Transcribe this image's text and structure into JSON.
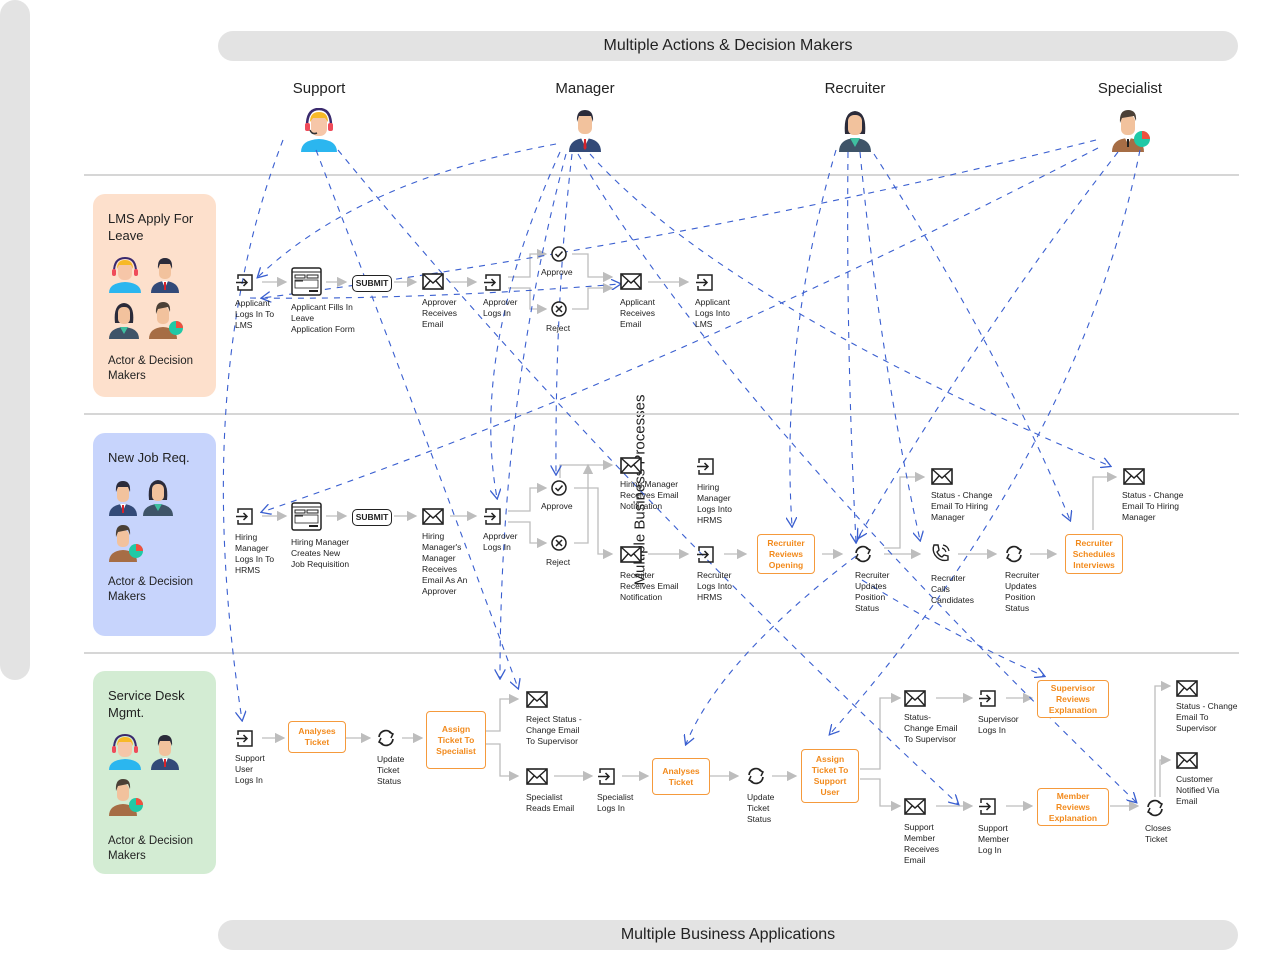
{
  "banners": {
    "top": "Multiple Actions & Decision Makers",
    "bottom": "Multiple Business Applications",
    "side": "Multiple Business Processes"
  },
  "actors": [
    {
      "name": "Support",
      "icon": "support-agent-headset-icon"
    },
    {
      "name": "Manager",
      "icon": "manager-icon"
    },
    {
      "name": "Recruiter",
      "icon": "recruiter-icon"
    },
    {
      "name": "Specialist",
      "icon": "specialist-icon"
    }
  ],
  "colors": {
    "lane_lms": "#fde0cc",
    "lane_job": "#c7d4fc",
    "lane_service": "#d3ecd3",
    "dashed_connector": "#3a5fd0",
    "flow_arrow": "#bdbdbd",
    "highlight_box": "#f28a1c"
  },
  "lanes": [
    {
      "title": "LMS Apply For Leave",
      "subtitle": "Actor & Decision Makers",
      "steps": [
        {
          "icon": "login-icon",
          "label": "Applicant\nLogs In To\nLMS"
        },
        {
          "icon": "form-window-icon",
          "label": "Applicant Fills In\nLeave\nApplication Form"
        },
        {
          "icon": "submit-button-icon",
          "label": "SUBMIT"
        },
        {
          "icon": "envelope-icon",
          "label": "Approver\nReceives\nEmail"
        },
        {
          "icon": "login-icon",
          "label": "Approver\nLogs In"
        },
        {
          "icon": "check-circle-icon",
          "label": "Approve"
        },
        {
          "icon": "x-circle-icon",
          "label": "Reject"
        },
        {
          "icon": "envelope-icon",
          "label": "Applicant\nReceives\nEmail"
        },
        {
          "icon": "login-icon",
          "label": "Applicant\nLogs Into\nLMS"
        }
      ]
    },
    {
      "title": "New Job Req.",
      "subtitle": "Actor & Decision Makers",
      "steps": [
        {
          "icon": "login-icon",
          "label": "Hiring\nManager\nLogs In To\nHRMS"
        },
        {
          "icon": "form-window-icon",
          "label": "Hiring Manager\nCreates New\nJob Requisition"
        },
        {
          "icon": "submit-button-icon",
          "label": "SUBMIT"
        },
        {
          "icon": "envelope-icon",
          "label": "Hiring\nManager's\nManager\nReceives\nEmail As An\nApprover"
        },
        {
          "icon": "login-icon",
          "label": "Approver\nLogs In"
        },
        {
          "icon": "check-circle-icon",
          "label": "Approve"
        },
        {
          "icon": "x-circle-icon",
          "label": "Reject"
        },
        {
          "icon": "envelope-icon",
          "label": "Hiring Manager\nReceives Email\nNotification"
        },
        {
          "icon": "login-icon",
          "label": "Hiring\nManager\nLogs Into\nHRMS"
        },
        {
          "icon": "envelope-icon",
          "label": "Recruiter\nReceives Email\nNotification"
        },
        {
          "icon": "login-icon",
          "label": "Recruiter\nLogs Into\nHRMS"
        },
        {
          "icon": "highlight-box",
          "label": "Recruiter\nReviews\nOpening"
        },
        {
          "icon": "refresh-icon",
          "label": "Recruiter\nUpdates\nPosition\nStatus"
        },
        {
          "icon": "envelope-icon",
          "label": "Status - Change\nEmail To Hiring\nManager"
        },
        {
          "icon": "phone-call-icon",
          "label": "Recruiter\nCalls\nCandidates"
        },
        {
          "icon": "refresh-icon",
          "label": "Recruiter\nUpdates\nPosition\nStatus"
        },
        {
          "icon": "highlight-box",
          "label": "Recruiter\nSchedules\nInterviews"
        },
        {
          "icon": "envelope-icon",
          "label": "Status - Change\nEmail To Hiring\nManager"
        }
      ]
    },
    {
      "title": "Service Desk Mgmt.",
      "subtitle": "Actor & Decision Makers",
      "steps": [
        {
          "icon": "login-icon",
          "label": "Support\nUser\nLogs In"
        },
        {
          "icon": "highlight-box",
          "label": "Analyses\nTicket"
        },
        {
          "icon": "refresh-icon",
          "label": "Update\nTicket\nStatus"
        },
        {
          "icon": "highlight-box",
          "label": "Assign\nTicket To\nSpecialist"
        },
        {
          "icon": "envelope-icon",
          "label": "Reject Status -\nChange Email\nTo Supervisor"
        },
        {
          "icon": "envelope-icon",
          "label": "Specialist\nReads Email"
        },
        {
          "icon": "login-icon",
          "label": "Specialist\nLogs In"
        },
        {
          "icon": "highlight-box",
          "label": "Analyses\nTicket"
        },
        {
          "icon": "refresh-icon",
          "label": "Update\nTicket\nStatus"
        },
        {
          "icon": "highlight-box",
          "label": "Assign\nTicket To\nSupport\nUser"
        },
        {
          "icon": "envelope-icon",
          "label": "Status-\nChange Email\nTo Supervisor"
        },
        {
          "icon": "login-icon",
          "label": "Supervisor\nLogs In"
        },
        {
          "icon": "highlight-box",
          "label": "Supervisor\nReviews\nExplanation"
        },
        {
          "icon": "envelope-icon",
          "label": "Support\nMember\nReceives\nEmail"
        },
        {
          "icon": "login-icon",
          "label": "Support\nMember\nLog In"
        },
        {
          "icon": "highlight-box",
          "label": "Member\nReviews\nExplanation"
        },
        {
          "icon": "refresh-icon",
          "label": "Closes\nTicket"
        },
        {
          "icon": "envelope-icon",
          "label": "Status - Change\nEmail To\nSupervisor"
        },
        {
          "icon": "envelope-icon",
          "label": "Customer\nNotified Via\nEmail"
        }
      ]
    }
  ]
}
